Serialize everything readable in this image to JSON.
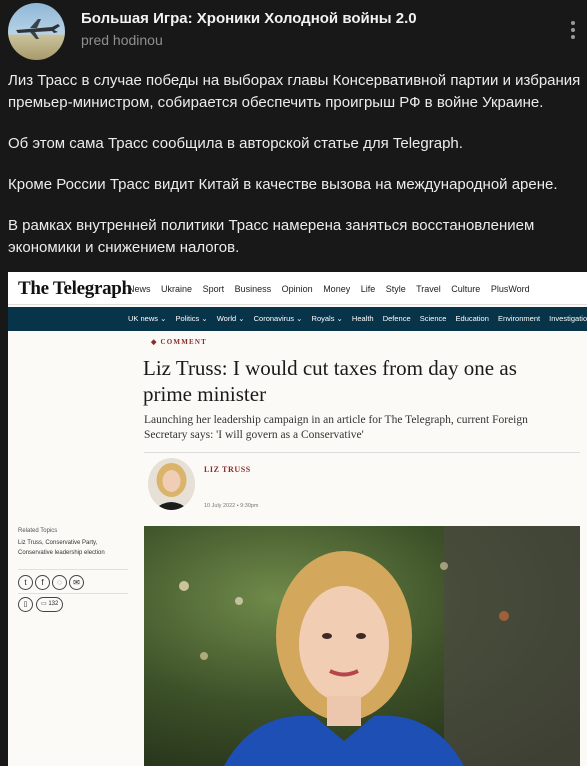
{
  "channel": {
    "name": "Большая Игра: Хроники Холодной войны 2.0",
    "time": "pred hodinou"
  },
  "post": {
    "paragraphs": [
      "Лиз Трасс в случае победы на выборах главы Консервативной партии и избрания премьер-министром, собирается обеспечить проигрыш РФ в войне Украине.",
      "Об этом сама Трасс сообщила в авторской статье для Telegraph.",
      "Кроме России Трасс видит Китай в качестве вызова на международной арене.",
      "В рамках внутренней политики Трасс намерена заняться восстановлением экономики и снижением налогов."
    ]
  },
  "article": {
    "logo": "The Telegraph",
    "nav": [
      "News",
      "Ukraine",
      "Sport",
      "Business",
      "Opinion",
      "Money",
      "Life",
      "Style",
      "Travel",
      "Culture",
      "PlusWord"
    ],
    "subnav": [
      "UK news ⌄",
      "Politics ⌄",
      "World ⌄",
      "Coronavirus ⌄",
      "Royals ⌄",
      "Health",
      "Defence",
      "Science",
      "Education",
      "Environment",
      "Investigations"
    ],
    "kicker": "◆ COMMENT",
    "headline": "Liz Truss: I would cut taxes from day one as prime minister",
    "standfirst": "Launching her leadership campaign in an article for The Telegraph, current Foreign Secretary says: 'I will govern as a Conservative'",
    "author": "LIZ TRUSS",
    "date": "10 July 2022 • 9:30pm",
    "related_label": "Related Topics",
    "related_topics": "Liz Truss, Conservative Party, Conservative leadership election",
    "comments_count": "132"
  },
  "colors": {
    "page_bg": "#181818",
    "subnav_bg": "#08344a",
    "accent": "#8a2c2c"
  }
}
